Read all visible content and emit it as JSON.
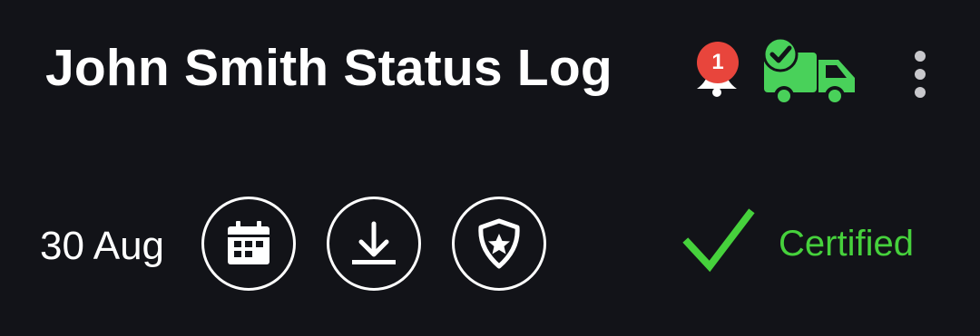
{
  "header": {
    "title": "John Smith Status Log",
    "notification_count": "1",
    "icons": [
      "bell-icon",
      "delivery-truck-check-icon",
      "more-vertical-icon"
    ]
  },
  "info_row": {
    "date": "30 Aug",
    "actions": [
      "calendar-icon",
      "download-icon",
      "police-badge-icon"
    ],
    "status_label": "Certified",
    "status_icon": "checkmark-icon"
  },
  "colors": {
    "background": "#121318",
    "text": "#ffffff",
    "badge": "#e8453c",
    "accent_green": "#46d13c",
    "truck_green": "#49d15a"
  }
}
